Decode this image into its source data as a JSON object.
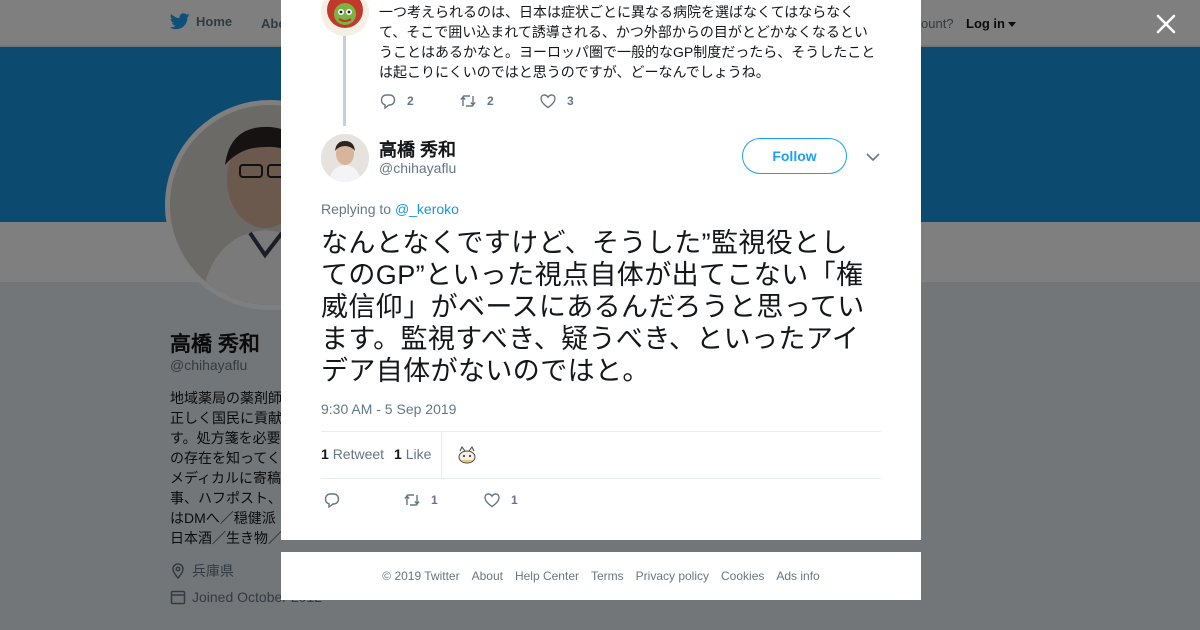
{
  "colors": {
    "brand": "#1da1f2",
    "banner": "#1b95e0",
    "overlay": "rgba(0,0,0,0.5)"
  },
  "nav": {
    "home": "Home",
    "about": "Abo",
    "account_prompt": "ccount?",
    "login": "Log in"
  },
  "profile": {
    "name": "高橋 秀和",
    "handle": "@chihayaflu",
    "bio_lines": [
      "地域薬局の薬剤師",
      "正しく国民に貢献",
      "す。処方箋を必要",
      "の存在を知ってく",
      "メディカルに寄稿",
      "事、ハフポスト、",
      "はDMへ／穏健派",
      "日本酒／生き物／"
    ],
    "location": "兵庫県",
    "joined": "Joined October 2012"
  },
  "parent_tweet": {
    "text": "一つ考えられるのは、日本は症状ごとに異なる病院を選ばなくてはならなくて、そこで囲い込まれて誘導される、かつ外部からの目がとどかなくなるということはあるかなと。ヨーロッパ圏で一般的なGP制度だったら、そうしたことは起こりにくいのではと思うのですが、どーなんでしょうね。",
    "replies": "2",
    "retweets": "2",
    "likes": "3"
  },
  "tweet": {
    "name": "高橋 秀和",
    "handle": "@chihayaflu",
    "follow_label": "Follow",
    "replying_prefix": "Replying to",
    "replying_to": "@_keroko",
    "text_lines": [
      "なんとなくですけど、そうした”監視役とし",
      "てのGP”といった視点自体が出てこない「権",
      "威信仰」がベースにあるんだろうと思ってい",
      "ます。監視すべき、疑うべき、といったアイ",
      "デア自体がないのではと。"
    ],
    "timestamp": "9:30 AM - 5 Sep 2019",
    "retweet_count": "1",
    "retweet_label": "Retweet",
    "like_count": "1",
    "like_label": "Like",
    "action_retweets": "1",
    "action_likes": "1"
  },
  "footer": {
    "copyright": "© 2019 Twitter",
    "links": [
      "About",
      "Help Center",
      "Terms",
      "Privacy policy",
      "Cookies",
      "Ads info"
    ]
  },
  "icons": [
    "twitter-bird-icon",
    "close-icon",
    "reply-icon",
    "retweet-icon",
    "heart-icon",
    "chevron-down-icon",
    "location-icon",
    "calendar-icon"
  ]
}
